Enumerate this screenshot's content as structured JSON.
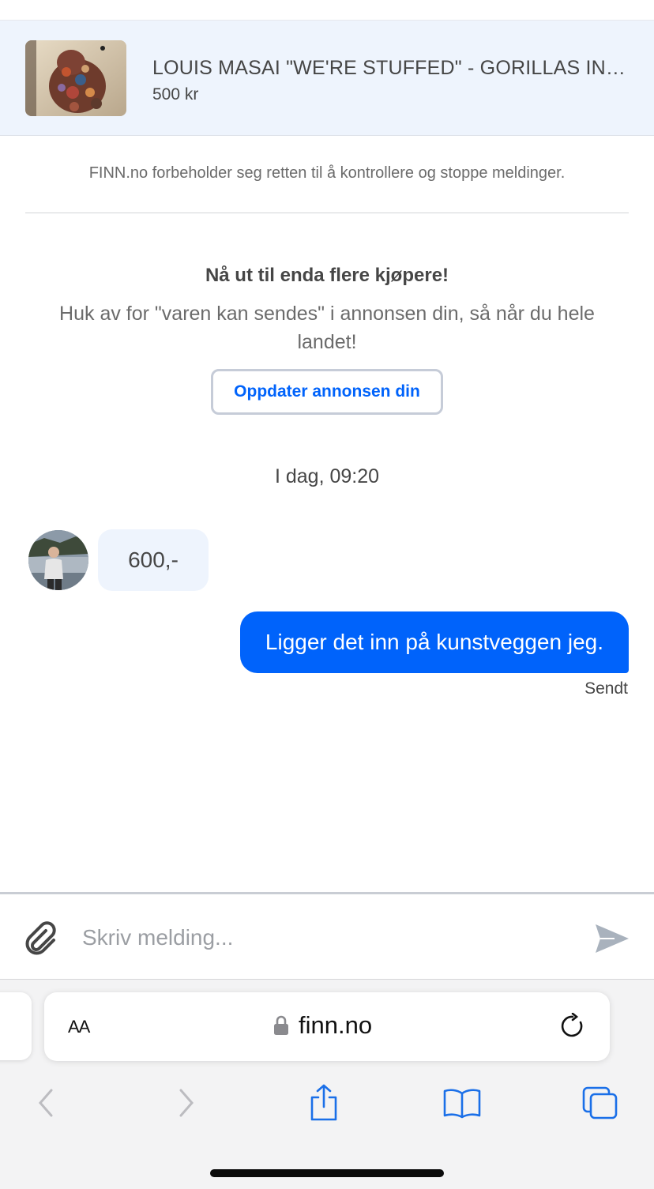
{
  "listing": {
    "title": "LOUIS MASAI \"WE'RE STUFFED\" - GORILLAS IN THE MIST",
    "price": "500 kr"
  },
  "disclaimer": "FINN.no forbeholder seg retten til å kontrollere og stoppe meldinger.",
  "promo": {
    "heading": "Nå ut til enda flere kjøpere!",
    "text": "Huk av for \"varen kan sendes\" i annonsen din, så når du hele landet!",
    "button_label": "Oppdater annonsen din"
  },
  "conversation": {
    "timestamp": "I dag, 09:20",
    "messages": [
      {
        "direction": "incoming",
        "text": "600,-"
      },
      {
        "direction": "outgoing",
        "text": "Ligger det inn på kunstveggen jeg.",
        "status": "Sendt"
      }
    ]
  },
  "composer": {
    "placeholder": "Skriv melding...",
    "attach_icon": "paperclip-icon",
    "send_icon": "send-arrow-icon"
  },
  "browser": {
    "text_size_label": "AA",
    "url": "finn.no",
    "toolbar_icons": [
      "back-icon",
      "forward-icon",
      "share-icon",
      "bookmarks-icon",
      "tabs-icon"
    ]
  },
  "colors": {
    "accent": "#0063fb",
    "listing_bg": "#eef4fd",
    "text": "#464646"
  }
}
